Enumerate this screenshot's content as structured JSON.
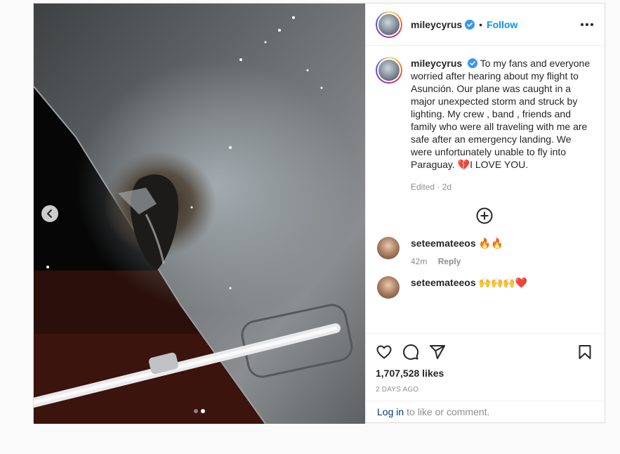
{
  "post": {
    "username": "mileycyrus",
    "follow_label": "Follow",
    "separator": "•",
    "caption": "To my fans and everyone worried after hearing about my flight to Asunción. Our plane was caught in a major unexpected storm and struck by lighting. My crew , band , friends and family who were all traveling with me are safe after an emergency landing. We were unfortunately unable to fly into Paraguay. 💔I LOVE YOU.",
    "caption_meta": "Edited · 2d",
    "likes": "1,707,528 likes",
    "posted": "2 DAYS AGO",
    "media": {
      "slide_count": 2,
      "active_slide": 2
    }
  },
  "comments": [
    {
      "username": "seteemateeos",
      "text": "🔥🔥",
      "time": "42m",
      "reply_label": "Reply"
    },
    {
      "username": "seteemateeos",
      "text": "🙌🙌🙌❤️"
    }
  ],
  "login": {
    "link": "Log in",
    "rest": "to like or comment."
  },
  "icons": {
    "prev": "chevron-left-icon",
    "verified": "verified-badge-icon",
    "more": "more-options-icon",
    "add": "add-circle-icon",
    "like": "heart-icon",
    "comment": "comment-icon",
    "share": "share-icon",
    "save": "bookmark-icon"
  },
  "colors": {
    "accent": "#0095f6",
    "verified": "#3897f0",
    "text": "#262626",
    "muted": "#8e8e8e"
  }
}
